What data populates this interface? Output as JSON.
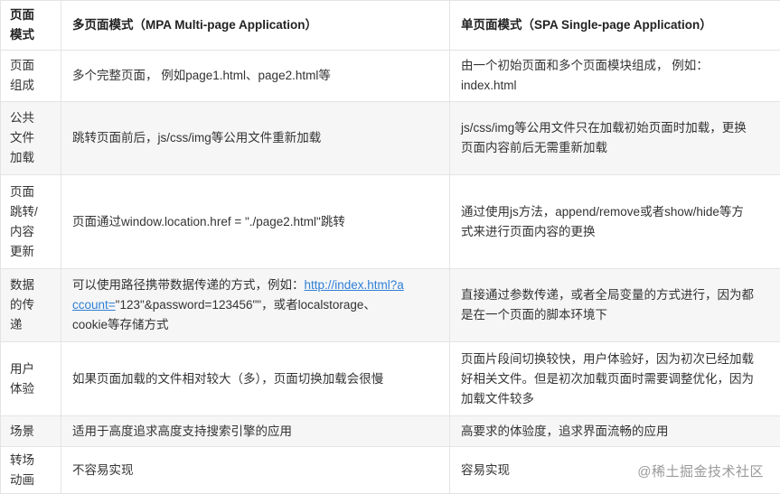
{
  "table": {
    "headers": [
      "页面\n模式",
      "多页面模式（MPA Multi-page Application）",
      "单页面模式（SPA Single-page Application）"
    ],
    "rows": [
      {
        "category": "页面\n组成",
        "mpa": "多个完整页面， 例如page1.html、page2.html等",
        "spa": "由一个初始页面和多个页面模块组成， 例如：\nindex.html"
      },
      {
        "category": "公共\n文件\n加载",
        "mpa": "跳转页面前后，js/css/img等公用文件重新加载",
        "spa": "js/css/img等公用文件只在加载初始页面时加载，更换\n页面内容前后无需重新加载"
      },
      {
        "category": "页面\n跳转/\n内容\n更新",
        "mpa": "页面通过window.location.href = \"./page2.html\"跳转",
        "spa": "通过使用js方法，append/remove或者show/hide等方\n式来进行页面内容的更换"
      },
      {
        "category": "数据\n的传\n递",
        "mpa_prefix": "可以使用路径携带数据传递的方式，例如：",
        "mpa_link_line1": "http://index.html?a",
        "mpa_link_line2": "ccount=",
        "mpa_suffix_line2": "\"123\"&password=123456\"\"，或者localstorage、",
        "mpa_line3": "cookie等存储方式",
        "spa": "直接通过参数传递，或者全局变量的方式进行，因为都\n是在一个页面的脚本环境下"
      },
      {
        "category": "用户\n体验",
        "mpa": "如果页面加载的文件相对较大（多），页面切换加载会很慢",
        "spa": "页面片段间切换较快，用户体验好，因为初次已经加载\n好相关文件。但是初次加载页面时需要调整优化，因为\n加载文件较多"
      },
      {
        "category": "场景",
        "mpa": "适用于高度追求高度支持搜索引擎的应用",
        "spa": "高要求的体验度，追求界面流畅的应用"
      },
      {
        "category": "转场\n动画",
        "mpa": "不容易实现",
        "spa": "容易实现"
      }
    ]
  },
  "watermark": "@稀土掘金技术社区"
}
